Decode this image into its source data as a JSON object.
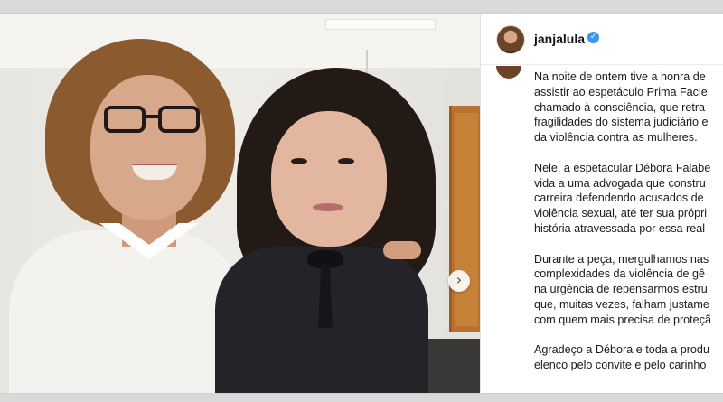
{
  "post": {
    "username": "janjalula",
    "verified_icon": "verified-badge-icon",
    "next_icon": "chevron-right-icon",
    "next_symbol": "›",
    "check_symbol": "✓",
    "caption": {
      "p1": [
        "Na noite de ontem tive a honra de",
        "assistir ao espetáculo Prima Facie",
        "chamado à consciência, que retra",
        "fragilidades do sistema judiciário e",
        "da violência contra as mulheres."
      ],
      "p2": [
        "Nele, a espetacular Débora Falabe",
        "vida a uma advogada que constru",
        "carreira defendendo acusados de",
        "violência sexual, até ter sua própri",
        "história atravessada por essa real"
      ],
      "p3": [
        "Durante a peça, mergulhamos nas",
        "complexidades da violência de gê",
        "na urgência de repensarmos estru",
        "que, muitas vezes, falham justame",
        "com quem mais precisa de proteçã"
      ],
      "p4": [
        "Agradeço a Débora e toda a produ",
        "elenco pelo convite e pelo carinho"
      ]
    }
  },
  "colors": {
    "verified": "#3897f0",
    "door": "#b8722e"
  }
}
